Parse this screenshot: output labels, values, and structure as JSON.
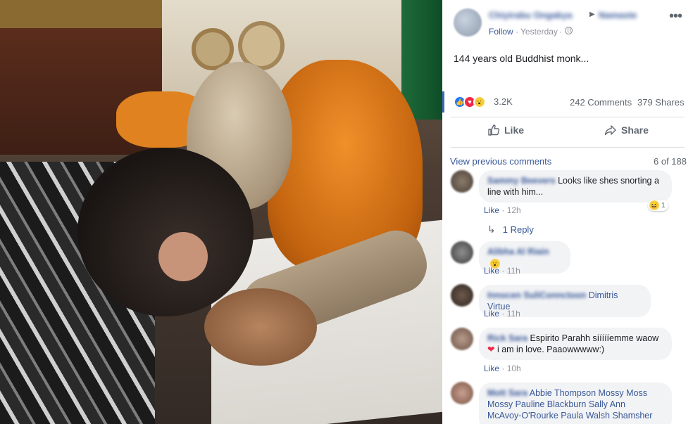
{
  "post": {
    "author_name": "Chiyirabu Ongakya",
    "target_name": "Namaste",
    "follow_label": "Follow",
    "meta_separator": "·",
    "time": "Yesterday",
    "time_separator": "·",
    "text": "144 years old Buddhist monk..."
  },
  "stats": {
    "reaction_count": "3.2K",
    "comments": "242 Comments",
    "shares": "379 Shares"
  },
  "actions": {
    "like_label": "Like",
    "share_label": "Share"
  },
  "comments_section": {
    "view_previous": "View previous comments",
    "count": "6 of 188",
    "comments": [
      {
        "name": "Sammy Beevers",
        "text": "Looks like shes snorting a line with him...",
        "like_label": "Like",
        "time": "12h",
        "reaction_count": "1",
        "reply_label": "1 Reply"
      },
      {
        "name": "Alibha Al Riain",
        "text": "",
        "like_label": "Like",
        "time": "11h"
      },
      {
        "name": "Innocen SuliConnctoon",
        "mention": "Dimitris Virtue",
        "like_label": "Like",
        "time": "11h"
      },
      {
        "name": "Rick Sara",
        "text": "Espirito Parahh síííííemme waow",
        "text2": "i am in love. Paaowwwww:)",
        "like_label": "Like",
        "time": "10h"
      },
      {
        "name": "Mott Sara",
        "mentions": "Abbie Thompson Mossy Moss",
        "mentions2": "Mossy Pauline Blackburn Sally Ann",
        "mentions3": "McAvoy-O'Rourke Paula Walsh Shamsher"
      }
    ]
  },
  "icons": {
    "more": "more-horizontal-icon",
    "globe": "globe-icon",
    "like": "thumbs-up-icon",
    "share": "share-arrow-icon",
    "reply": "reply-arrow-icon"
  },
  "colors": {
    "link": "#385898",
    "meta": "#90949c",
    "bubble": "#f2f3f5",
    "like_blue": "#2078f4",
    "love_red": "#f0284a",
    "wow_yellow": "#f7d14b"
  }
}
